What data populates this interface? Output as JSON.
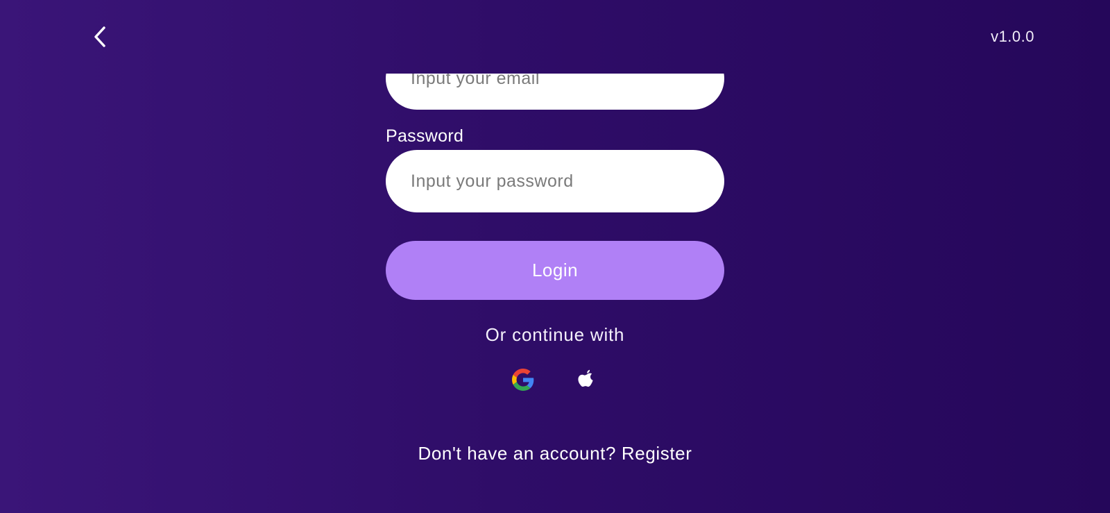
{
  "header": {
    "back_icon": "chevron-left-icon",
    "version": "v1.0.0"
  },
  "form": {
    "email": {
      "placeholder": "Input your email",
      "value": ""
    },
    "password": {
      "label": "Password",
      "placeholder": "Input your password",
      "value": ""
    },
    "login_label": "Login",
    "continue_with": "Or continue with",
    "social": [
      {
        "name": "google-icon"
      },
      {
        "name": "apple-icon"
      }
    ],
    "register_text": "Don't have an account? Register"
  },
  "colors": {
    "background_start": "#3a1578",
    "background_end": "#25075a",
    "button": "#b080f6",
    "input_bg": "#ffffff",
    "placeholder": "#7a7a7a"
  }
}
